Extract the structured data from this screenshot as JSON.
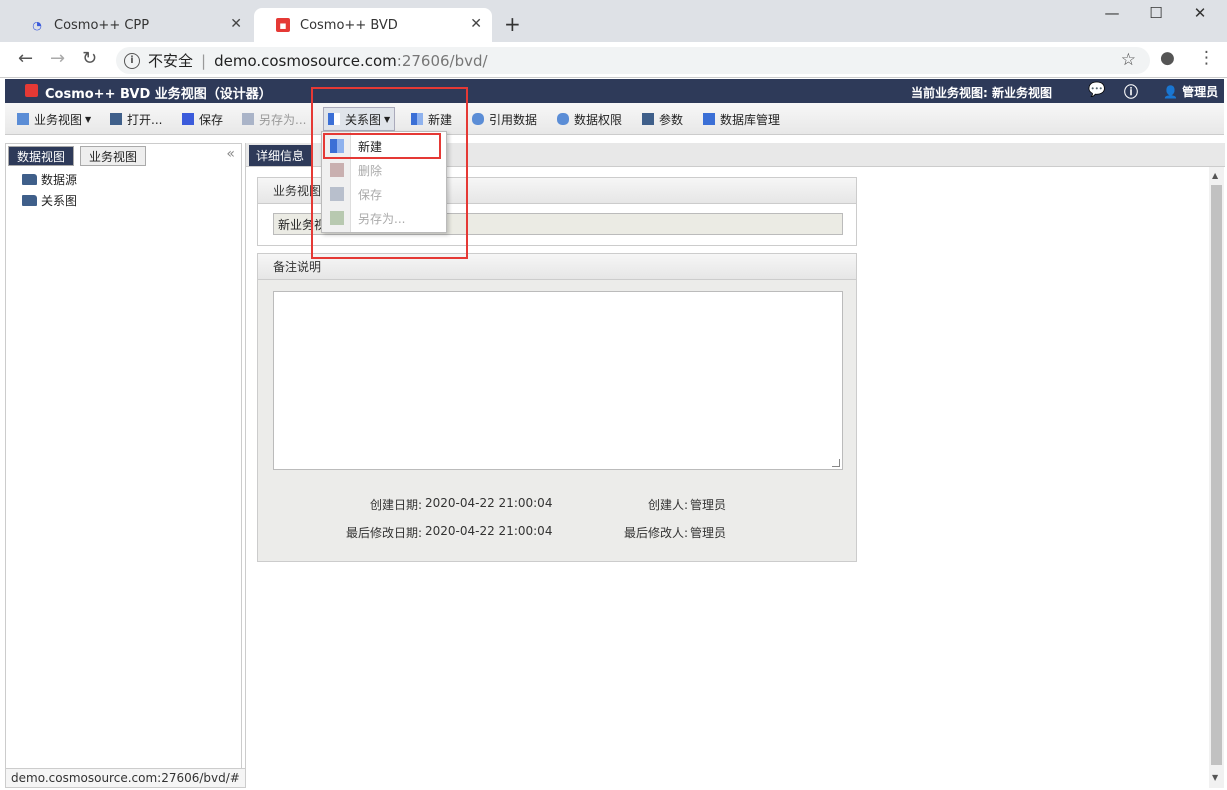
{
  "browser": {
    "tabs": [
      {
        "title": "Cosmo++ CPP"
      },
      {
        "title": "Cosmo++ BVD"
      }
    ],
    "security_label": "不安全",
    "url_host": "demo.cosmosource.com",
    "url_rest": ":27606/bvd/",
    "window_controls": [
      "minimize-icon",
      "maximize-icon",
      "close-icon"
    ]
  },
  "app": {
    "title": "Cosmo++ BVD 业务视图（设计器）",
    "current_view": "当前业务视图: 新业务视图",
    "user": "管理员"
  },
  "toolbar": {
    "business_view": "业务视图",
    "open": "打开...",
    "save": "保存",
    "save_as": "另存为...",
    "relation": "关系图",
    "new": "新建",
    "ref_data": "引用数据",
    "data_perm": "数据权限",
    "params": "参数",
    "db_manage": "数据库管理"
  },
  "left": {
    "tabs": [
      "数据视图",
      "业务视图"
    ],
    "tree": [
      "数据源",
      "关系图"
    ]
  },
  "main": {
    "tab": "详细信息",
    "name_label": "业务视图",
    "name_value": "新业务视",
    "notes_label": "备注说明",
    "created_date_label": "创建日期:",
    "created_date": "2020-04-22 21:00:04",
    "creator_label": "创建人:",
    "creator": "管理员",
    "modified_date_label": "最后修改日期:",
    "modified_date": "2020-04-22 21:00:04",
    "modifier_label": "最后修改人:",
    "modifier": "管理员"
  },
  "dropdown": {
    "items": [
      {
        "label": "新建",
        "enabled": true
      },
      {
        "label": "删除",
        "enabled": false
      },
      {
        "label": "保存",
        "enabled": false
      },
      {
        "label": "另存为...",
        "enabled": false
      }
    ]
  },
  "status_url": "demo.cosmosource.com:27606/bvd/#",
  "colors": {
    "header_bg": "#2e3a59",
    "highlight": "#e53935"
  }
}
